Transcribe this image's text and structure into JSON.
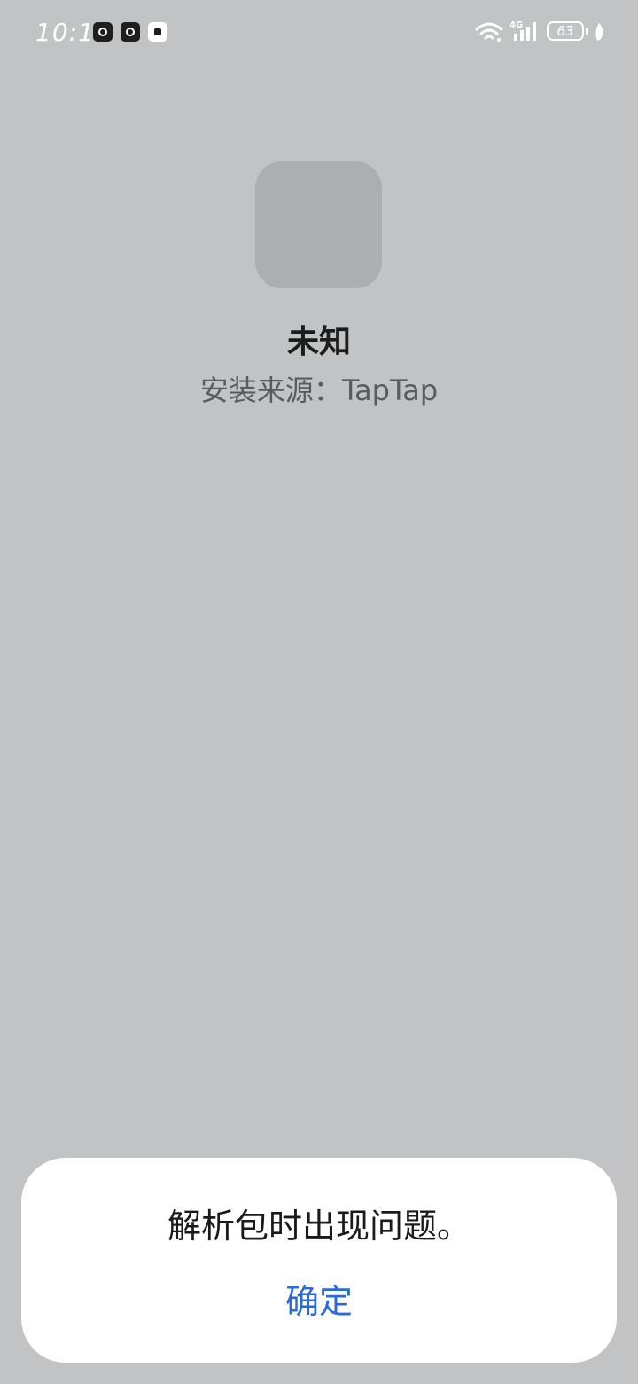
{
  "status_bar": {
    "time": "10:17",
    "network_type": "4G",
    "battery_level": "63",
    "icons": [
      "notification-app-icon",
      "notification-app-icon",
      "notification-app-icon",
      "wifi-icon",
      "cellular-signal-icon",
      "battery-icon",
      "leaf-icon"
    ]
  },
  "app": {
    "name": "未知",
    "source": "安装来源：TapTap"
  },
  "dialog": {
    "message": "解析包时出现问题。",
    "confirm_label": "确定"
  },
  "colors": {
    "background": "#c2c3c5",
    "dialog_background": "#ffffff",
    "accent": "#2a6bd6",
    "icon_placeholder": "#adaeb0"
  }
}
